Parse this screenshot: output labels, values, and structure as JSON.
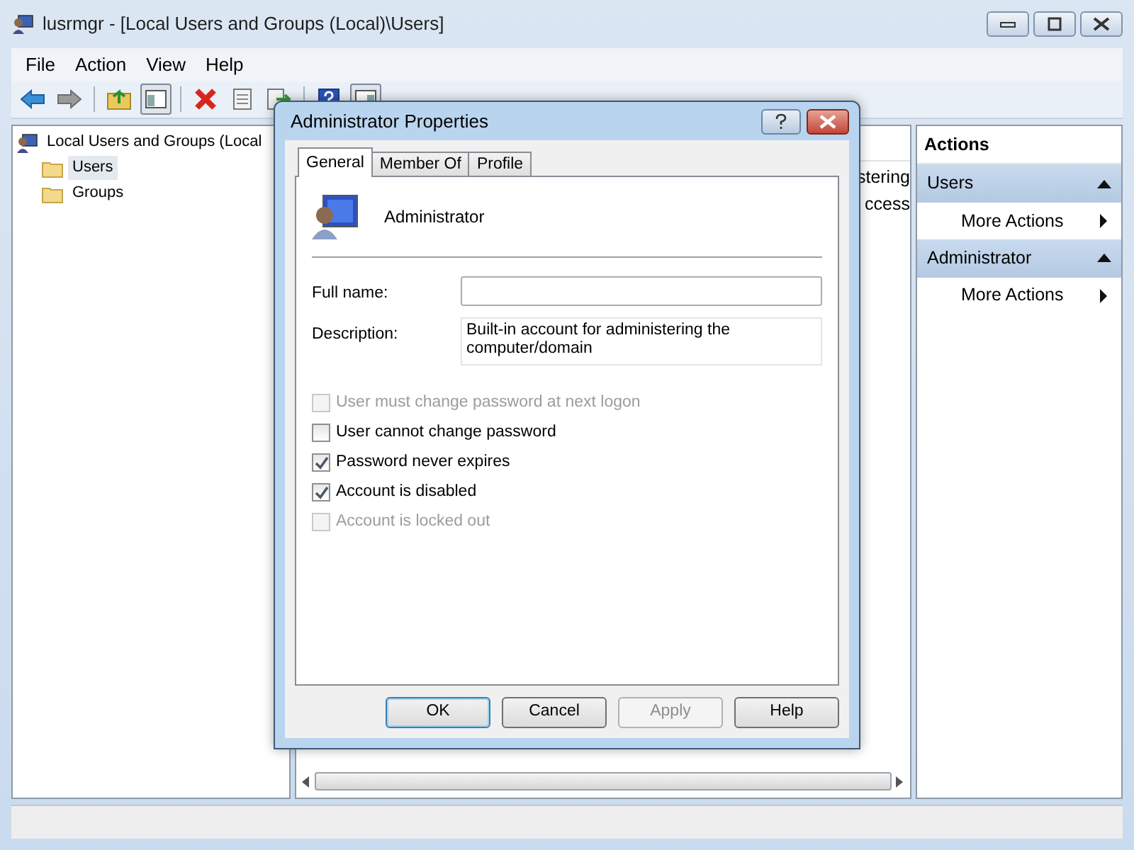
{
  "window": {
    "title": "lusrmgr - [Local Users and Groups (Local)\\Users]"
  },
  "menu": [
    {
      "label": "File"
    },
    {
      "label": "Action"
    },
    {
      "label": "View"
    },
    {
      "label": "Help"
    }
  ],
  "tree": [
    {
      "label": "Local Users and Groups (Local",
      "selected": false,
      "children": [
        {
          "label": "Users",
          "selected": true
        },
        {
          "label": "Groups",
          "selected": false
        }
      ]
    }
  ],
  "list_rows": [
    {
      "text": "stering"
    },
    {
      "text": "ccess"
    }
  ],
  "actions": {
    "title": "Actions",
    "sections": [
      {
        "header": "Users",
        "items": [
          "More Actions"
        ]
      },
      {
        "header": "Administrator",
        "items": [
          "More Actions"
        ]
      }
    ]
  },
  "dialog": {
    "title": "Administrator Properties",
    "tabs": [
      {
        "label": "General",
        "selected": true
      },
      {
        "label": "Member Of",
        "selected": false
      },
      {
        "label": "Profile",
        "selected": false
      }
    ],
    "user_name": "Administrator",
    "fields": [
      {
        "label": "Full name:",
        "kind": "single"
      },
      {
        "label": "Description:",
        "kind": "multi",
        "value": "Built-in account for administering the computer/domain"
      }
    ],
    "checkboxes": [
      {
        "label": "User must change password at next logon",
        "checked": false,
        "disabled": true
      },
      {
        "label": "User cannot change password",
        "checked": false,
        "disabled": false
      },
      {
        "label": "Password never expires",
        "checked": true,
        "disabled": false
      },
      {
        "label": "Account is disabled",
        "checked": true,
        "disabled": false
      },
      {
        "label": "Account is locked out",
        "checked": false,
        "disabled": true
      }
    ],
    "buttons": [
      {
        "label": "OK",
        "default": true,
        "disabled": false
      },
      {
        "label": "Cancel",
        "default": false,
        "disabled": false
      },
      {
        "label": "Apply",
        "default": false,
        "disabled": true
      },
      {
        "label": "Help",
        "default": false,
        "disabled": false
      }
    ]
  }
}
